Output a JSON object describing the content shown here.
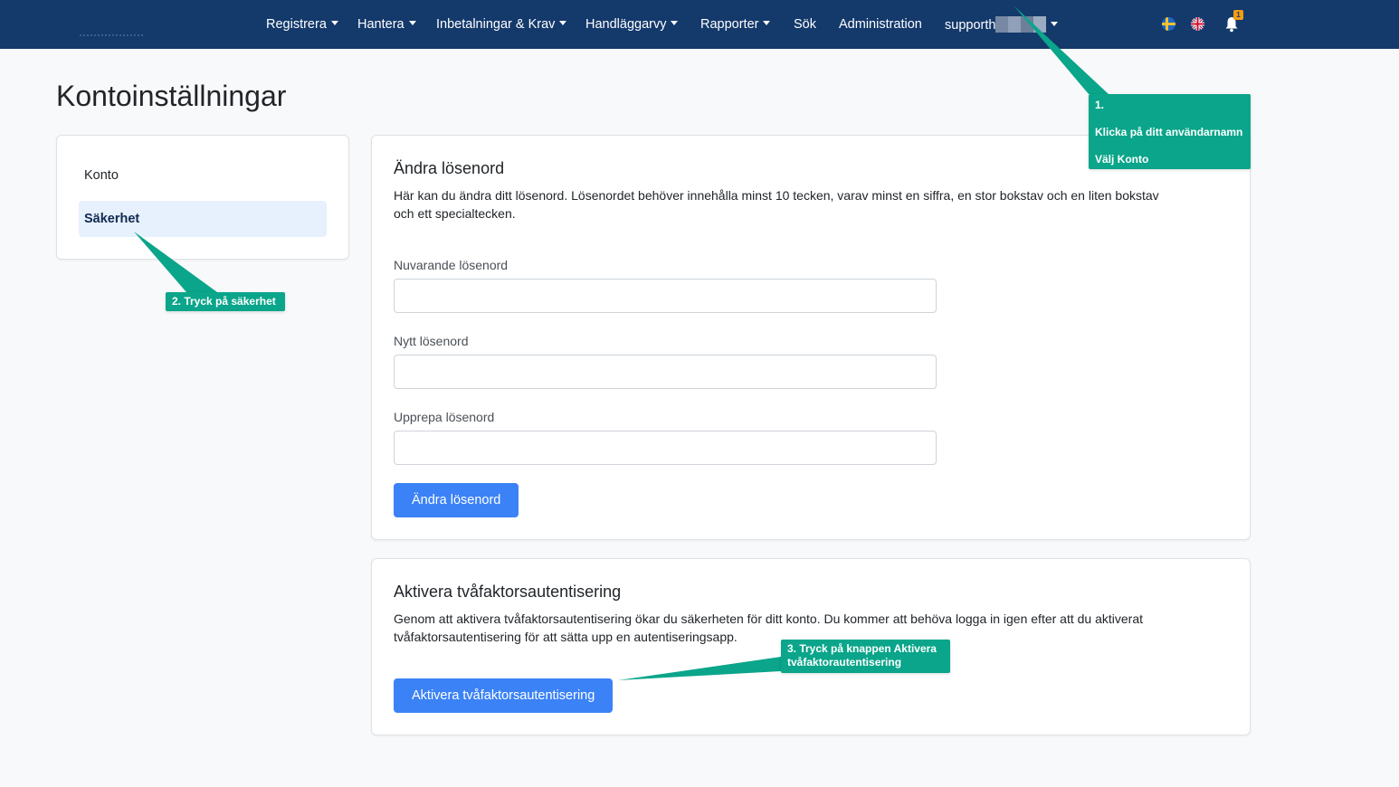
{
  "nav": {
    "items": [
      {
        "label": "Registrera",
        "dropdown": true
      },
      {
        "label": "Hantera",
        "dropdown": true
      },
      {
        "label": "Inbetalningar & Krav",
        "dropdown": true
      },
      {
        "label": "Handläggarvy",
        "dropdown": true
      },
      {
        "label": "Rapporter",
        "dropdown": true
      },
      {
        "label": "Sök",
        "dropdown": false
      },
      {
        "label": "Administration",
        "dropdown": false
      }
    ],
    "user": {
      "label": "supporth"
    },
    "flags": {
      "swedish": "flag-se-icon",
      "english": "flag-gb-icon"
    },
    "notifications": {
      "count": "1"
    }
  },
  "page": {
    "title": "Kontoinställningar"
  },
  "sidebar": {
    "items": [
      {
        "label": "Konto",
        "active": false
      },
      {
        "label": "Säkerhet",
        "active": true
      }
    ]
  },
  "change_password": {
    "title": "Ändra lösenord",
    "description": "Här kan du ändra ditt lösenord. Lösenordet behöver innehålla minst 10 tecken, varav minst en siffra, en stor bokstav och en liten bokstav och ett specialtecken.",
    "current_label": "Nuvarande lösenord",
    "current_value": "",
    "new_label": "Nytt lösenord",
    "new_value": "",
    "repeat_label": "Upprepa lösenord",
    "repeat_value": "",
    "button": "Ändra lösenord"
  },
  "two_factor": {
    "title": "Aktivera tvåfaktorsautentisering",
    "description": "Genom att aktivera tvåfaktorsautentisering ökar du säkerheten för ditt konto. Du kommer att behöva logga in igen efter att du aktiverat tvåfaktorsautentisering för att sätta upp en autentiseringsapp.",
    "button": "Aktivera tvåfaktorsautentisering"
  },
  "callouts": {
    "step1": {
      "line1": "1.",
      "line2": "Klicka på ditt användarnamn",
      "line3": "Välj Konto"
    },
    "step2": {
      "text": "2. Tryck på säkerhet"
    },
    "step3": {
      "text": "3. Tryck på knappen Aktivera tvåfaktorautentisering"
    }
  },
  "colors": {
    "navbar": "#14396b",
    "primary_button": "#3b82f6",
    "callout": "#0aa58a",
    "active_item": "#e7f0fd",
    "badge": "#f39c12"
  }
}
